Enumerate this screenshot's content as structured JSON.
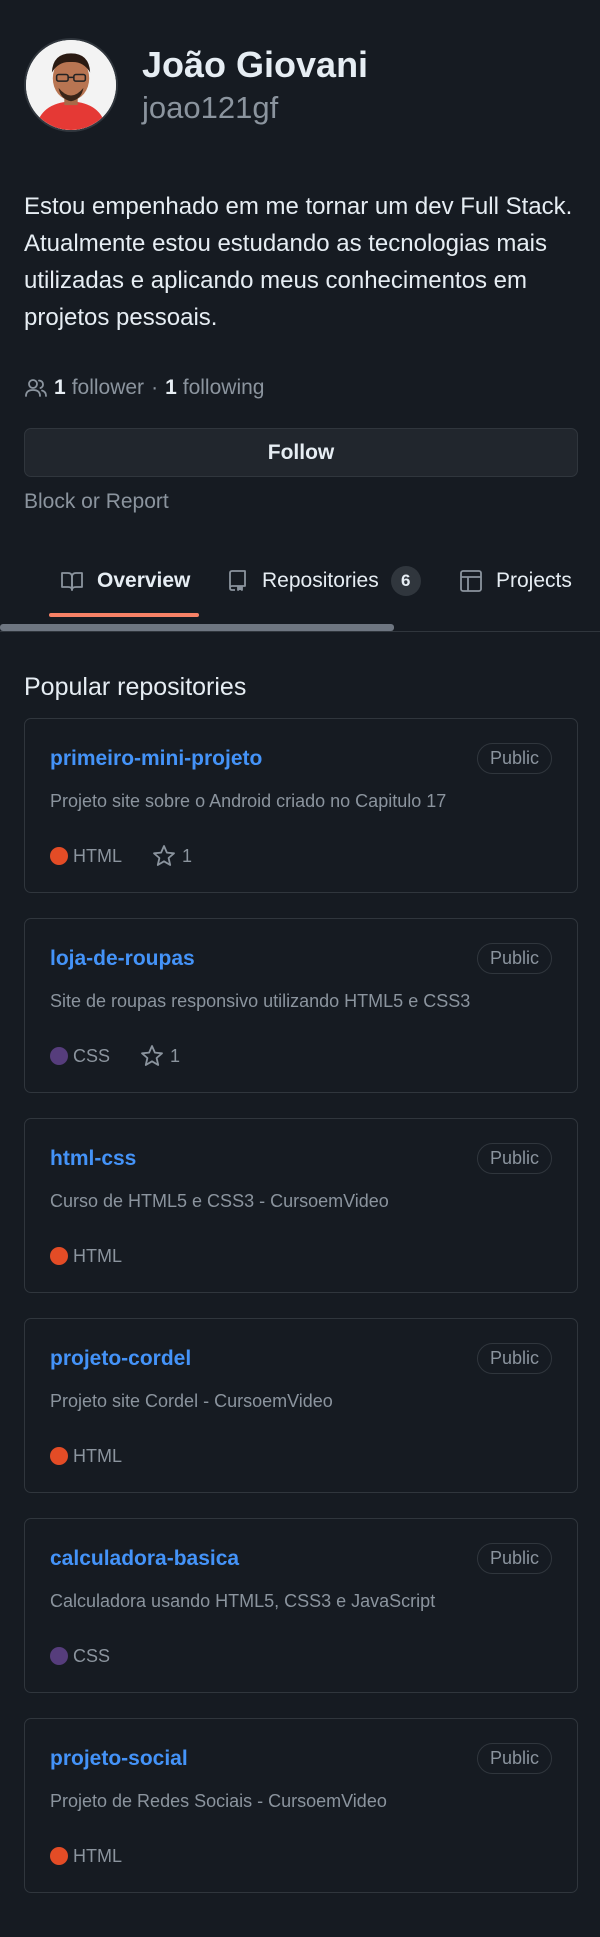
{
  "profile": {
    "full_name": "João Giovani",
    "username": "joao121gf",
    "bio": "Estou empenhado em me tornar um dev Full Stack. Atualmente estou estudando as tecnologias mais utilizadas e aplicando meus conhecimentos em projetos pessoais.",
    "followers_count": "1",
    "followers_label": "follower",
    "separator": "·",
    "following_count": "1",
    "following_label": "following",
    "follow_button": "Follow",
    "block_report": "Block or Report"
  },
  "tabs": [
    {
      "label": "Overview",
      "icon": "book-icon",
      "active": true
    },
    {
      "label": "Repositories",
      "icon": "repo-icon",
      "counter": "6"
    },
    {
      "label": "Projects",
      "icon": "table-icon"
    }
  ],
  "section_title": "Popular repositories",
  "colors": {
    "background": "#161b22",
    "link": "#4493f8",
    "tab_underline": "#f78166",
    "html_lang": "#e34c26",
    "css_lang": "#563d7c"
  },
  "repos": [
    {
      "name": "primeiro-mini-projeto",
      "visibility": "Public",
      "description": "Projeto site sobre o Android criado no Capitulo 17",
      "language": "HTML",
      "lang_color": "#e34c26",
      "stars": "1"
    },
    {
      "name": "loja-de-roupas",
      "visibility": "Public",
      "description": "Site de roupas responsivo utilizando HTML5 e CSS3",
      "language": "CSS",
      "lang_color": "#563d7c",
      "stars": "1"
    },
    {
      "name": "html-css",
      "visibility": "Public",
      "description": "Curso de HTML5 e CSS3 - CursoemVideo",
      "language": "HTML",
      "lang_color": "#e34c26"
    },
    {
      "name": "projeto-cordel",
      "visibility": "Public",
      "description": "Projeto site Cordel - CursoemVideo",
      "language": "HTML",
      "lang_color": "#e34c26"
    },
    {
      "name": "calculadora-basica",
      "visibility": "Public",
      "description": "Calculadora usando HTML5, CSS3 e JavaScript",
      "language": "CSS",
      "lang_color": "#563d7c"
    },
    {
      "name": "projeto-social",
      "visibility": "Public",
      "description": "Projeto de Redes Sociais - CursoemVideo",
      "language": "HTML",
      "lang_color": "#e34c26"
    }
  ]
}
